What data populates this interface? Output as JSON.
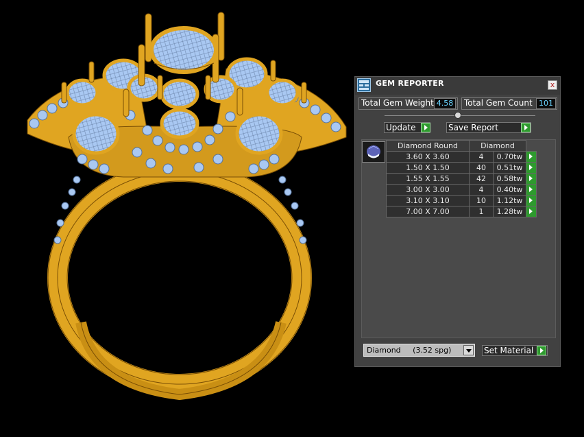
{
  "panel": {
    "title": "GEM REPORTER",
    "close_label": "x",
    "total_gem_weight_label": "Total Gem Weight",
    "total_gem_weight": "4.58",
    "total_gem_count_label": "Total Gem Count",
    "total_gem_count": "101",
    "update_label": "Update",
    "save_report_label": "Save Report",
    "table": {
      "headers": [
        "Diamond Round",
        "Diamond"
      ],
      "rows": [
        {
          "size": "3.60 X 3.60",
          "count": "4",
          "weight": "0.70tw"
        },
        {
          "size": "1.50 X 1.50",
          "count": "40",
          "weight": "0.51tw"
        },
        {
          "size": "1.55 X 1.55",
          "count": "42",
          "weight": "0.58tw"
        },
        {
          "size": "3.00 X 3.00",
          "count": "4",
          "weight": "0.40tw"
        },
        {
          "size": "3.10 X 3.10",
          "count": "10",
          "weight": "1.12tw"
        },
        {
          "size": "7.00 X 7.00",
          "count": "1",
          "weight": "1.28tw"
        }
      ]
    },
    "material_value": "Diamond     (3.52 spg)",
    "set_material_label": "Set Material"
  },
  "colors": {
    "metal": "#e0a521",
    "metal_edge": "#7a4f05",
    "gem": "#a9c8f2",
    "gem_edge": "#56739c",
    "accent_value": "#6ad4ff",
    "go_green": "#2e9a2e"
  },
  "icons": [
    "gem-reporter-icon",
    "close-icon",
    "arrow-right-icon",
    "dropdown-arrow-icon",
    "diamond-round-icon"
  ]
}
